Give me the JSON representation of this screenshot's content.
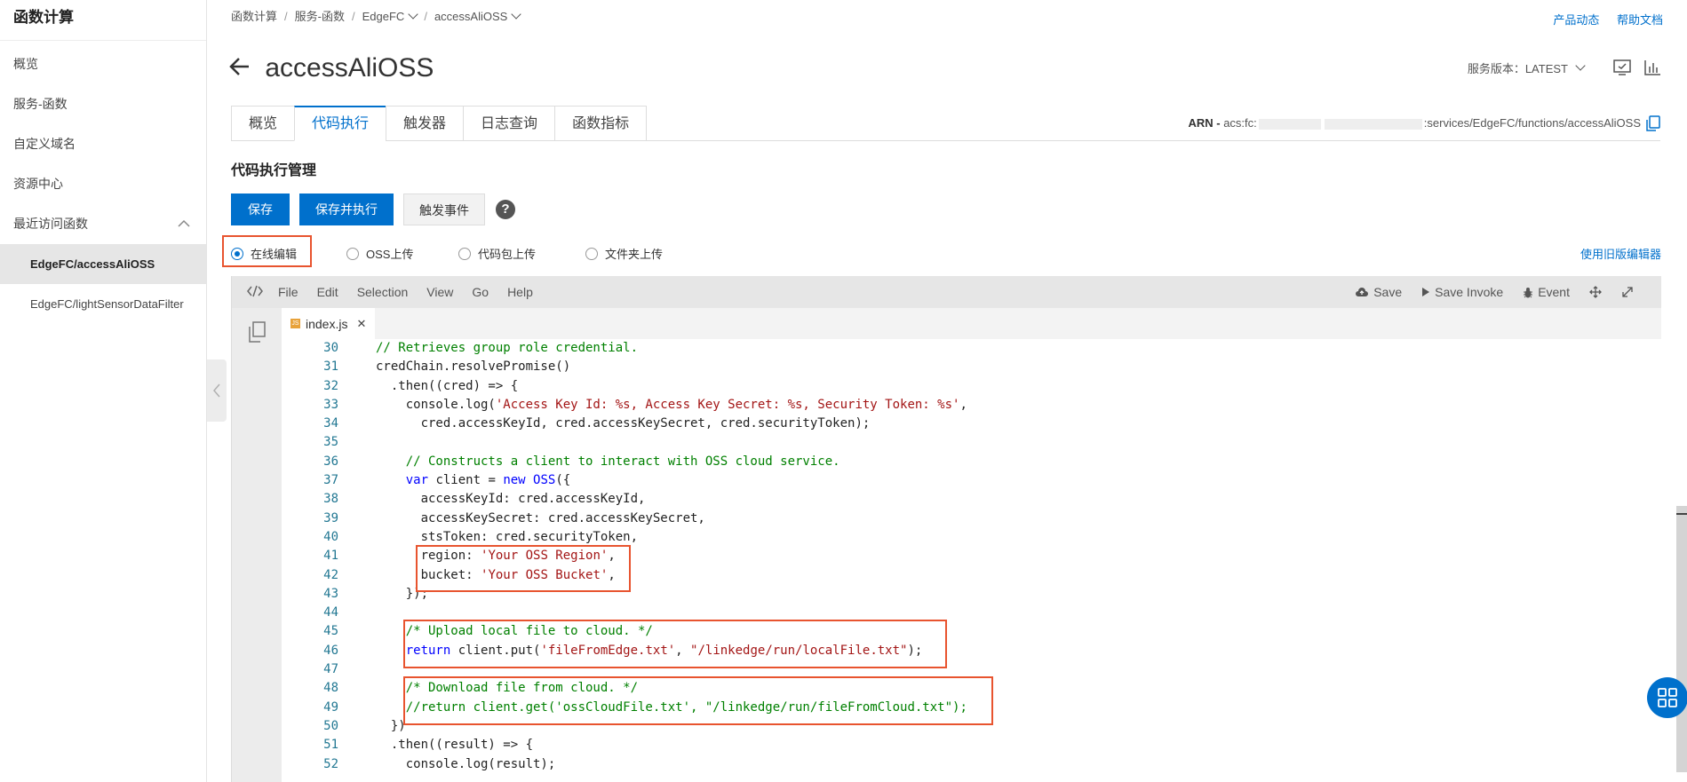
{
  "sidebar": {
    "brand": "函数计算",
    "items": [
      {
        "label": "概览"
      },
      {
        "label": "服务-函数"
      },
      {
        "label": "自定义域名"
      },
      {
        "label": "资源中心"
      },
      {
        "label": "最近访问函数"
      }
    ],
    "recent": [
      {
        "label": "EdgeFC/accessAliOSS"
      },
      {
        "label": "EdgeFC/lightSensorDataFilter"
      }
    ]
  },
  "breadcrumb": [
    "函数计算",
    "服务-函数",
    "EdgeFC",
    "accessAliOSS"
  ],
  "top_links": {
    "updates": "产品动态",
    "docs": "帮助文档"
  },
  "page": {
    "title": "accessAliOSS",
    "version_label": "服务版本：LATEST"
  },
  "tabs": [
    "概览",
    "代码执行",
    "触发器",
    "日志查询",
    "函数指标"
  ],
  "arn": {
    "prefix": "ARN - ",
    "head": "acs:fc:",
    "tail": ":services/EdgeFC/functions/accessAliOSS"
  },
  "section_title": "代码执行管理",
  "buttons": {
    "save": "保存",
    "save_run": "保存并执行",
    "trigger": "触发事件"
  },
  "upload_options": [
    "在线编辑",
    "OSS上传",
    "代码包上传",
    "文件夹上传"
  ],
  "old_editor_link": "使用旧版编辑器",
  "editor": {
    "menus": [
      "File",
      "Edit",
      "Selection",
      "View",
      "Go",
      "Help"
    ],
    "actions": {
      "save": "Save",
      "save_invoke": "Save Invoke",
      "event": "Event"
    },
    "file_tab": "index.js",
    "js_badge": "JS",
    "lines": [
      {
        "n": "30",
        "t": "// Retrieves group role credential."
      },
      {
        "n": "31",
        "t": "credChain.resolvePromise()"
      },
      {
        "n": "32",
        "t": "  .then((cred) => {"
      },
      {
        "n": "33",
        "t": "    console.log('Access Key Id: %s, Access Key Secret: %s, Security Token: %s',"
      },
      {
        "n": "34",
        "t": "      cred.accessKeyId, cred.accessKeySecret, cred.securityToken);"
      },
      {
        "n": "35",
        "t": ""
      },
      {
        "n": "36",
        "t": "    // Constructs a client to interact with OSS cloud service."
      },
      {
        "n": "37",
        "t": "    var client = new OSS({"
      },
      {
        "n": "38",
        "t": "      accessKeyId: cred.accessKeyId,"
      },
      {
        "n": "39",
        "t": "      accessKeySecret: cred.accessKeySecret,"
      },
      {
        "n": "40",
        "t": "      stsToken: cred.securityToken,"
      },
      {
        "n": "41",
        "t": "      region: 'Your OSS Region',"
      },
      {
        "n": "42",
        "t": "      bucket: 'Your OSS Bucket',"
      },
      {
        "n": "43",
        "t": "    });"
      },
      {
        "n": "44",
        "t": ""
      },
      {
        "n": "45",
        "t": "    /* Upload local file to cloud. */"
      },
      {
        "n": "46",
        "t": "    return client.put('fileFromEdge.txt', \"/linkedge/run/localFile.txt\");"
      },
      {
        "n": "47",
        "t": ""
      },
      {
        "n": "48",
        "t": "    /* Download file from cloud. */"
      },
      {
        "n": "49",
        "t": "    //return client.get('ossCloudFile.txt', \"/linkedge/run/fileFromCloud.txt\");"
      },
      {
        "n": "50",
        "t": "  })"
      },
      {
        "n": "51",
        "t": "  .then((result) => {"
      },
      {
        "n": "52",
        "t": "    console.log(result);"
      }
    ]
  }
}
